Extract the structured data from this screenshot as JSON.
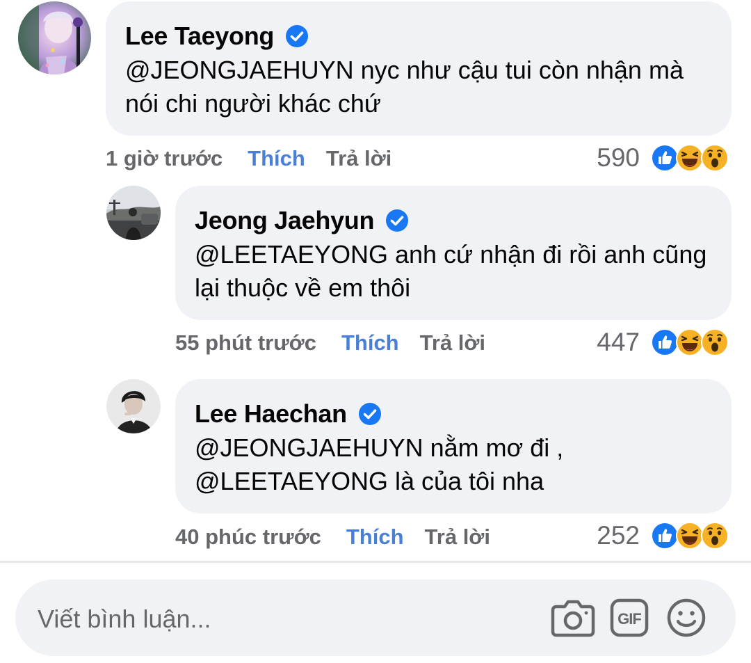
{
  "comments": [
    {
      "name": "Lee Taeyong",
      "line1": "@JEONGJAEHUYN  nyc như cậu tui còn nhận mà",
      "line2": "nói chi người khác chứ",
      "time": "1 giờ trước",
      "like_label": "Thích",
      "reply_label": "Trả lời",
      "reaction_count": "590"
    },
    {
      "name": "Jeong Jaehyun",
      "line1": "@LEETAEYONG anh cứ nhận đi rồi anh cũng",
      "line2": "lại thuộc về em thôi",
      "time": "55 phút trước",
      "like_label": "Thích",
      "reply_label": "Trả lời",
      "reaction_count": "447"
    },
    {
      "name": "Lee Haechan",
      "line1": "@JEONGJAEHUYN nằm mơ đi ,",
      "line2": "@LEETAEYONG là của tôi nha",
      "time": "40 phúc trước",
      "like_label": "Thích",
      "reply_label": "Trả lời",
      "reaction_count": "252"
    }
  ],
  "composer": {
    "placeholder": "Viết bình luận...",
    "camera_icon": "camera-icon",
    "gif_icon": "gif-icon",
    "sticker_icon": "smiley-icon"
  },
  "colors": {
    "bubble": "#f0f2f5",
    "verified": "#1877f2",
    "like_link": "#4a7fd6",
    "muted": "#65676b",
    "like_reaction": "#1877f2",
    "haha_reaction": "#f7b125"
  }
}
